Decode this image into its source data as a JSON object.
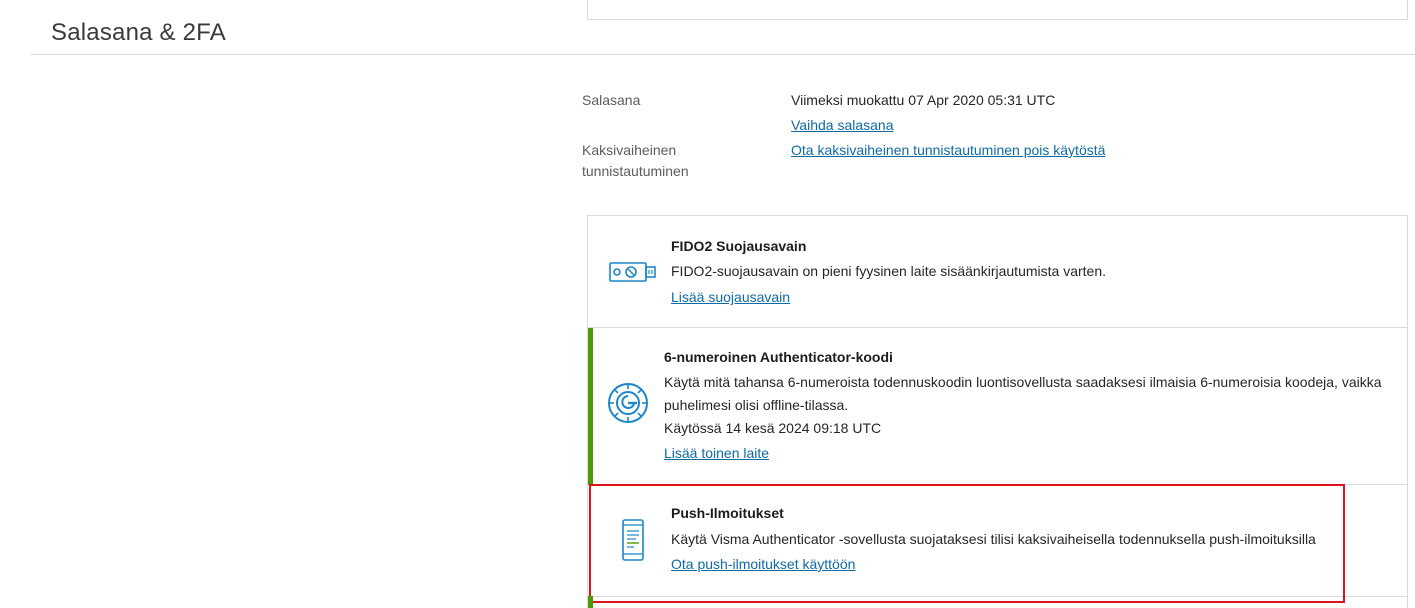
{
  "page": {
    "title": "Salasana & 2FA"
  },
  "password_row": {
    "label": "Salasana",
    "last_modified": "Viimeksi muokattu 07 Apr 2020 05:31 UTC",
    "change_link": "Vaihda salasana"
  },
  "twofa_row": {
    "label_line1": "Kaksivaiheinen",
    "label_line2": "tunnistautuminen",
    "disable_link": "Ota kaksivaiheinen tunnistautuminen pois käytöstä"
  },
  "methods": {
    "fido2": {
      "title": "FIDO2 Suojausavain",
      "description": "FIDO2-suojausavain on pieni fyysinen laite sisäänkirjautumista varten.",
      "link": "Lisää suojausavain",
      "icon": "usb-key-icon"
    },
    "authenticator": {
      "title": "6-numeroinen Authenticator-koodi",
      "description_line1": "Käytä mitä tahansa 6-numeroista todennuskoodin luontisovellusta saadaksesi ilmaisia 6-numeroisia koodeja, vaikka",
      "description_line2": "puhelimesi olisi offline-tilassa.",
      "in_use": "Käytössä 14 kesä 2024 09:18 UTC",
      "link": "Lisää toinen laite",
      "icon": "authenticator-icon"
    },
    "push": {
      "title": "Push-Ilmoitukset",
      "description": "Käytä Visma Authenticator -sovellusta suojataksesi tilisi kaksivaiheisella todennuksella push-ilmoituksilla",
      "link": "Ota push-ilmoitukset käyttöön",
      "icon": "phone-icon"
    }
  },
  "colors": {
    "link": "#0f6aa6",
    "active_border": "#4f9800",
    "highlight_border": "#d9141c",
    "icon_blue": "#1b87c9"
  }
}
